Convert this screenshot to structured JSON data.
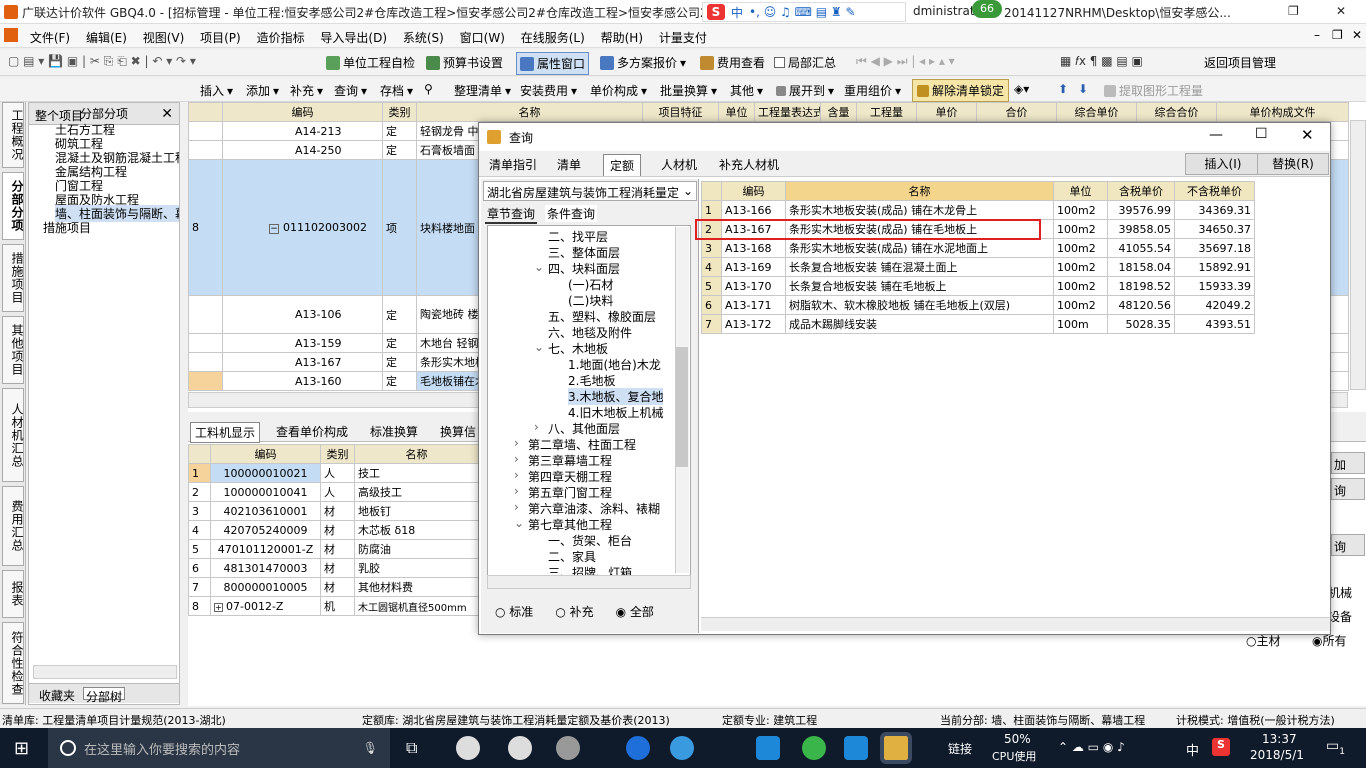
{
  "app": {
    "title": "广联达计价软件 GBQ4.0 - [招标管理 - 单位工程:恒安孝感公司2#仓库改造工程>恒安孝感公司2#仓库改造工程>恒安孝感公司2#...",
    "path": "dministrat",
    "path2": "20141127NRHM\\Desktop\\恒安孝感公...",
    "badge": "66"
  },
  "menu": [
    "文件(F)",
    "编辑(E)",
    "视图(V)",
    "项目(P)",
    "造价指标",
    "导入导出(D)",
    "系统(S)",
    "窗口(W)",
    "在线服务(L)",
    "帮助(H)",
    "计量支付"
  ],
  "toolbar1": [
    "单位工程自检",
    "预算书设置",
    "属性窗口",
    "多方案报价",
    "费用查看",
    "局部汇总",
    "返回项目管理"
  ],
  "toolbar2": [
    "插入",
    "添加",
    "补充",
    "查询",
    "存档",
    "整理清单",
    "安装费用",
    "单价构成",
    "批量换算",
    "其他",
    "展开到",
    "重用组价",
    "解除清单锁定",
    "提取图形工程量"
  ],
  "vtabs": [
    "工程概况",
    "分部分项",
    "措施项目",
    "其他项目",
    "人材机汇总",
    "费用汇总",
    "报表",
    "符合性检查"
  ],
  "tree": {
    "header": "分部分项",
    "items": [
      "整个项目",
      "土石方工程",
      "砌筑工程",
      "混凝土及钢筋混凝土工程",
      "金属结构工程",
      "门窗工程",
      "屋面及防水工程",
      "墙、柱面装饰与隔断、幕墙工程",
      "措施项目"
    ],
    "tabs": [
      "收藏夹",
      "分部树"
    ]
  },
  "main": {
    "headers": [
      "编码",
      "类别",
      "名称",
      "项目特征",
      "单位",
      "工程量表达式",
      "含量",
      "工程量",
      "单价",
      "合价",
      "综合单价",
      "综合合价",
      "单价构成文件"
    ],
    "rows": [
      {
        "no": "",
        "code": "A14-213",
        "type": "定",
        "name": "轻钢龙骨 中距(mm以内)"
      },
      {
        "no": "",
        "code": "A14-250",
        "type": "定",
        "name": "石膏板墙面"
      },
      {
        "no": "8",
        "code": "011102003002",
        "type": "项",
        "name": "块料楼地面"
      },
      {
        "no": "",
        "code": "A13-106",
        "type": "定",
        "name": "陶瓷地砖 楼地面 泥砂浆"
      },
      {
        "no": "",
        "code": "A13-159",
        "type": "定",
        "name": "木地台 轻钢地龙骨"
      },
      {
        "no": "",
        "code": "A13-167",
        "type": "定",
        "name": "条形实木地板安装"
      },
      {
        "no": "",
        "code": "A13-160",
        "type": "定",
        "name": "毛地板铺在木龙骨"
      }
    ],
    "right_edge": [
      "程",
      "程",
      "程",
      "程",
      "程",
      "程",
      "程"
    ]
  },
  "bottom": {
    "tabs": [
      "工料机显示",
      "查看单价构成",
      "标准换算",
      "换算信"
    ],
    "headers": [
      "编码",
      "类别",
      "名称"
    ],
    "rows": [
      {
        "no": "1",
        "code": "100000010021",
        "type": "人",
        "name": "技工"
      },
      {
        "no": "2",
        "code": "100000010041",
        "type": "人",
        "name": "高级技工"
      },
      {
        "no": "3",
        "code": "402103610001",
        "type": "材",
        "name": "地板钉"
      },
      {
        "no": "4",
        "code": "420705240009",
        "type": "材",
        "name": "木芯板 δ18"
      },
      {
        "no": "5",
        "code": "470101120001-Z",
        "type": "材",
        "name": "防腐油"
      },
      {
        "no": "6",
        "code": "481301470003",
        "type": "材",
        "name": "乳胶"
      },
      {
        "no": "7",
        "code": "800000010005",
        "type": "材",
        "name": "其他材料费"
      },
      {
        "no": "8",
        "code": "07-0012-Z",
        "type": "机",
        "name": "木工圆锯机直径500mm"
      }
    ],
    "right": [
      "加",
      "询",
      "询",
      "机械",
      "设备",
      "主材",
      "所有"
    ]
  },
  "dialog": {
    "title": "查询",
    "tabs": [
      "清单指引",
      "清单",
      "定额",
      "人材机",
      "补充人材机"
    ],
    "insert": "插入(I)",
    "replace": "替换(R)",
    "lib": "湖北省房屋建筑与装饰工程消耗量定",
    "subtabs": [
      "章节查询",
      "条件查询"
    ],
    "tree": [
      "二、找平层",
      "三、整体面层",
      "四、块料面层",
      "(一)石材",
      "(二)块料",
      "五、塑料、橡胶面层",
      "六、地毯及附件",
      "七、木地板",
      "1.地面(地台)木龙",
      "2.毛地板",
      "3.木地板、复合地",
      "4.旧木地板上机械",
      "八、其他面层",
      "第二章墙、柱面工程",
      "第三章幕墙工程",
      "第四章天棚工程",
      "第五章门窗工程",
      "第六章油漆、涂料、裱糊",
      "第七章其他工程",
      "一、货架、柜台",
      "二、家具",
      "三、招牌、灯箱"
    ],
    "radios": [
      "标准",
      "补充",
      "全部"
    ],
    "headers": [
      "编码",
      "名称",
      "单位",
      "含税单价",
      "不含税单价"
    ],
    "rows": [
      {
        "no": "1",
        "code": "A13-166",
        "name": "条形实木地板安装(成品) 铺在木龙骨上",
        "unit": "100m2",
        "tax": "39576.99",
        "notax": "34369.31"
      },
      {
        "no": "2",
        "code": "A13-167",
        "name": "条形实木地板安装(成品) 铺在毛地板上",
        "unit": "100m2",
        "tax": "39858.05",
        "notax": "34650.37"
      },
      {
        "no": "3",
        "code": "A13-168",
        "name": "条形实木地板安装(成品) 铺在水泥地面上",
        "unit": "100m2",
        "tax": "41055.54",
        "notax": "35697.18"
      },
      {
        "no": "4",
        "code": "A13-169",
        "name": "长条复合地板安装 铺在混凝土面上",
        "unit": "100m2",
        "tax": "18158.04",
        "notax": "15892.91"
      },
      {
        "no": "5",
        "code": "A13-170",
        "name": "长条复合地板安装 铺在毛地板上",
        "unit": "100m2",
        "tax": "18198.52",
        "notax": "15933.39"
      },
      {
        "no": "6",
        "code": "A13-171",
        "name": "树脂软木、软木橡胶地板 铺在毛地板上(双层)",
        "unit": "100m2",
        "tax": "48120.56",
        "notax": "42049.2"
      },
      {
        "no": "7",
        "code": "A13-172",
        "name": "成品木踢脚线安装",
        "unit": "100m",
        "tax": "5028.35",
        "notax": "4393.51"
      }
    ]
  },
  "status": {
    "qd": "清单库: 工程量清单项目计量规范(2013-湖北)",
    "de": "定额库: 湖北省房屋建筑与装饰工程消耗量定额及基价表(2013)",
    "zy": "定额专业: 建筑工程",
    "fb": "当前分部: 墙、柱面装饰与隔断、幕墙工程",
    "js": "计税模式: 增值税(一般计税方法)"
  },
  "taskbar": {
    "search": "在这里输入你要搜索的内容",
    "link": "链接",
    "cpu": "50%",
    "cpu_label": "CPU使用",
    "ime": "中",
    "time": "13:37",
    "date": "2018/5/1",
    "notif": "1"
  }
}
